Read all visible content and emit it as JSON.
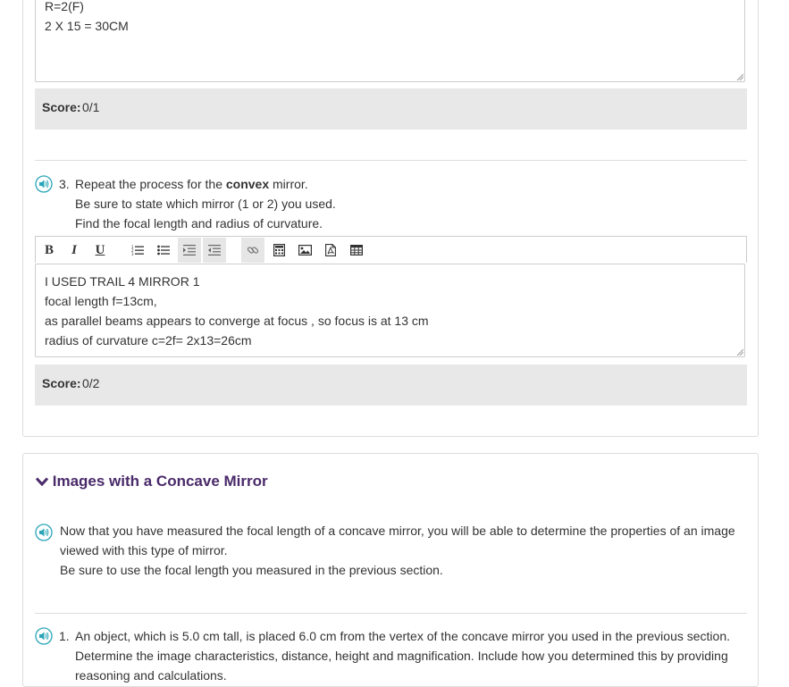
{
  "q2": {
    "answer_lines": [
      "R=2(F)",
      "2 X 15 = 30CM"
    ],
    "score_label": "Score:",
    "score_value": "0/1"
  },
  "q3": {
    "number": "3.",
    "line1_before": "Repeat the process for the ",
    "line1_bold": "convex",
    "line1_after": " mirror.",
    "line2": "Be sure to state which mirror (1 or 2) you used.",
    "line3": "Find the focal length and radius of curvature.",
    "answer_lines": [
      "I USED TRAIL 4 MIRROR 1",
      "focal length f=13cm,",
      "as parallel beams appears to converge at focus , so focus is at 13 cm",
      "radius of curvature c=2f= 2x13=26cm"
    ],
    "score_label": "Score:",
    "score_value": "0/2"
  },
  "toolbar": {
    "bold": "B",
    "italic": "I",
    "underline": "U"
  },
  "section": {
    "title": "Images with a Concave Mirror",
    "intro_lines": [
      "Now that you have measured the focal length of a concave mirror, you will be able to determine the properties of an image",
      "viewed with this type of mirror.",
      "Be sure to use the focal length you measured in the previous section."
    ],
    "q1_number": "1.",
    "q1_lines": [
      "An object, which is 5.0 cm tall, is placed 6.0 cm from the vertex of the concave mirror you used in the previous section.",
      "Determine the image characteristics, distance, height and magnification. Include how you determined this by providing",
      "reasoning and calculations."
    ]
  },
  "colors": {
    "accent_icon": "#2aa5b8",
    "section_title": "#4a2a6a",
    "score_bg": "#e8e8e8"
  }
}
